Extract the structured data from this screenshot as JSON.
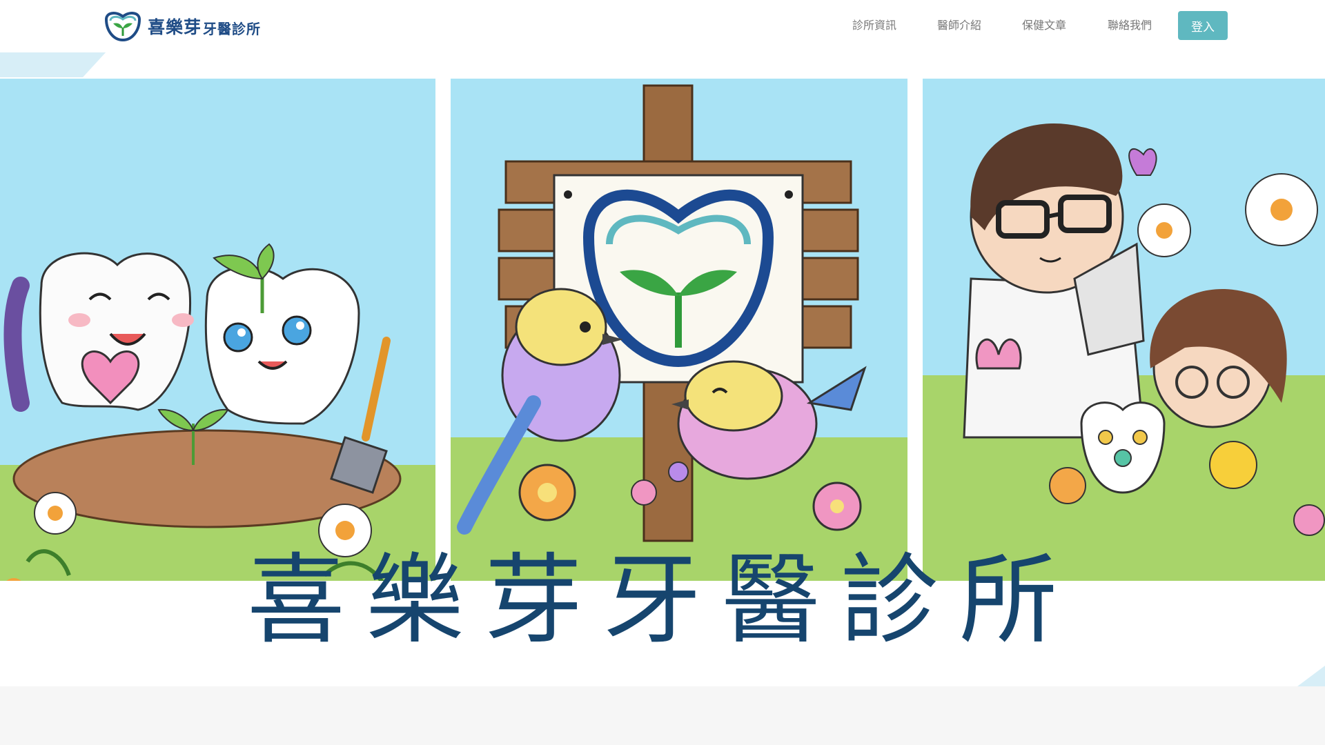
{
  "header": {
    "logo_main": "喜樂芽",
    "logo_sub": "牙醫診所",
    "nav": [
      {
        "label": "診所資訊"
      },
      {
        "label": "醫師介紹"
      },
      {
        "label": "保健文章"
      },
      {
        "label": "聯絡我們"
      }
    ],
    "login_label": "登入"
  },
  "hero": {
    "title": "喜樂芽牙醫診所"
  },
  "colors": {
    "brand_blue": "#1f4c86",
    "login_teal": "#5fb8c0",
    "sky": "#a9e3f5",
    "grass": "#a8d46a"
  }
}
